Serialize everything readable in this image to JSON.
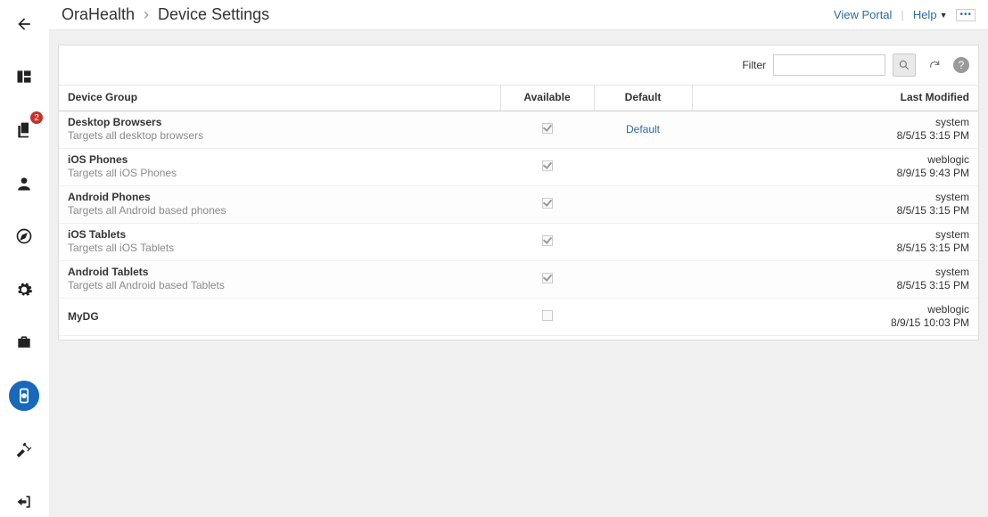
{
  "sidebar": {
    "items": [
      {
        "name": "back"
      },
      {
        "name": "dashboard"
      },
      {
        "name": "pages",
        "badge": "2"
      },
      {
        "name": "users"
      },
      {
        "name": "explore"
      },
      {
        "name": "settings"
      },
      {
        "name": "toolbox"
      },
      {
        "name": "device",
        "active": true
      },
      {
        "name": "build"
      },
      {
        "name": "exit"
      }
    ]
  },
  "topbar": {
    "app": "OraHealth",
    "page": "Device Settings",
    "view_portal": "View Portal",
    "help": "Help"
  },
  "filterbar": {
    "label": "Filter",
    "value": ""
  },
  "table": {
    "columns": {
      "group": "Device Group",
      "available": "Available",
      "default": "Default",
      "modified": "Last Modified"
    },
    "rows": [
      {
        "name": "Desktop Browsers",
        "desc": "Targets all desktop browsers",
        "available": true,
        "default": "Default",
        "user": "system",
        "time": "8/5/15 3:15 PM"
      },
      {
        "name": "iOS Phones",
        "desc": "Targets all iOS Phones",
        "available": true,
        "default": "",
        "user": "weblogic",
        "time": "8/9/15 9:43 PM"
      },
      {
        "name": "Android Phones",
        "desc": "Targets all Android based phones",
        "available": true,
        "default": "",
        "user": "system",
        "time": "8/5/15 3:15 PM"
      },
      {
        "name": "iOS Tablets",
        "desc": "Targets all iOS Tablets",
        "available": true,
        "default": "",
        "user": "system",
        "time": "8/5/15 3:15 PM"
      },
      {
        "name": "Android Tablets",
        "desc": "Targets all Android based Tablets",
        "available": true,
        "default": "",
        "user": "system",
        "time": "8/5/15 3:15 PM"
      },
      {
        "name": "MyDG",
        "desc": "",
        "available": false,
        "default": "",
        "user": "weblogic",
        "time": "8/9/15 10:03 PM"
      }
    ]
  }
}
